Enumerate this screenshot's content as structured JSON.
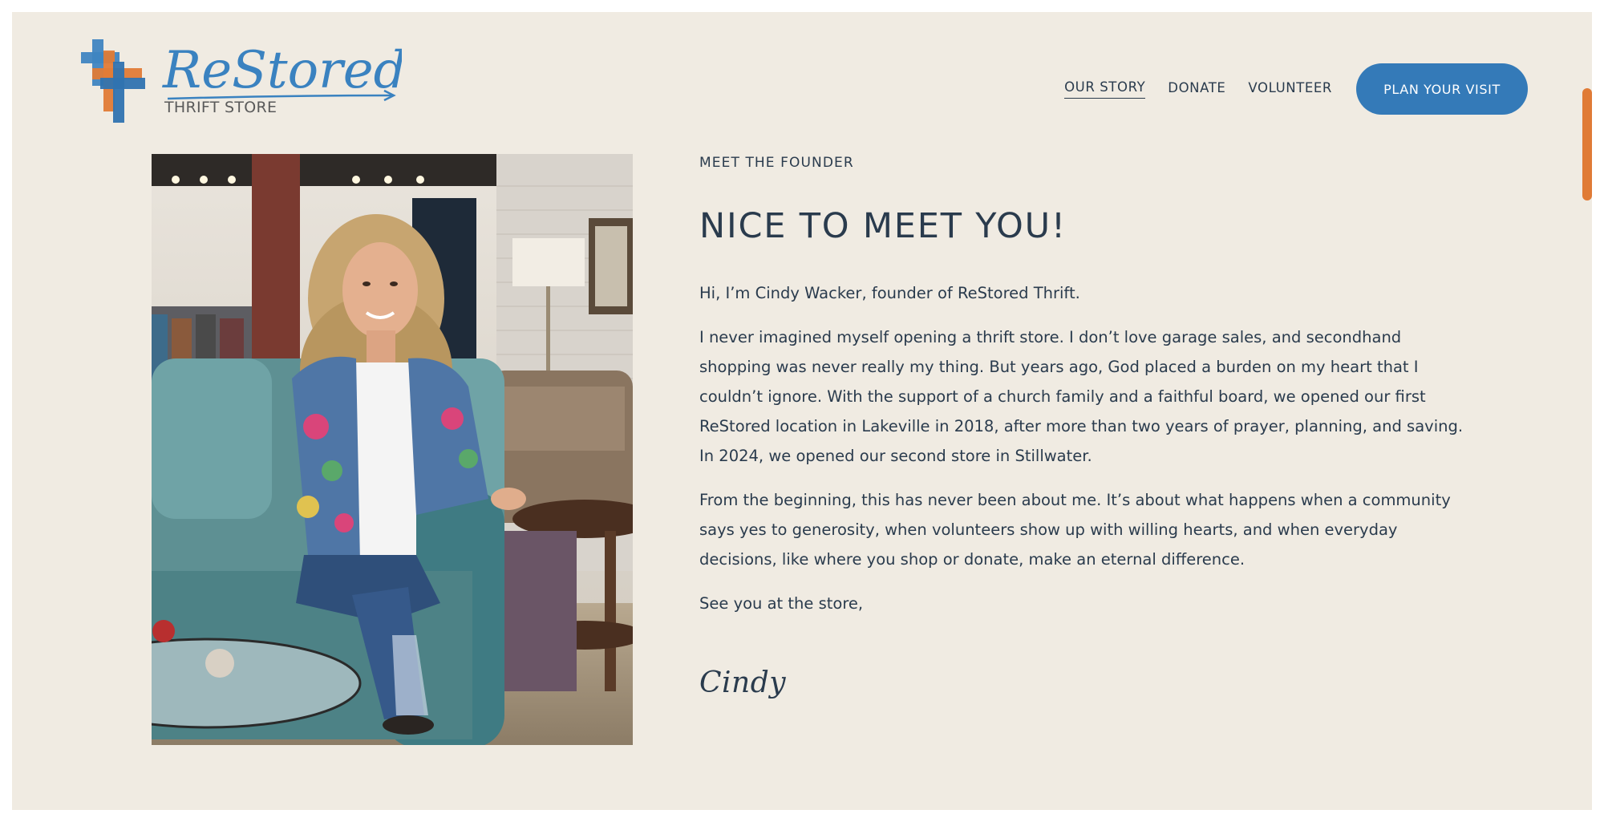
{
  "brand": {
    "name": "ReStored",
    "tagline": "THRIFT STORE"
  },
  "nav": {
    "items": [
      {
        "label": "OUR STORY",
        "active": true
      },
      {
        "label": "DONATE",
        "active": false
      },
      {
        "label": "VOLUNTEER",
        "active": false
      }
    ],
    "cta_label": "PLAN YOUR VISIT"
  },
  "colors": {
    "background": "#f0ebe2",
    "text": "#2a3b4d",
    "accent_blue": "#347ab8",
    "accent_orange": "#e07b36"
  },
  "founder": {
    "eyebrow": "MEET THE FOUNDER",
    "headline": "NICE TO MEET YOU!",
    "paragraphs": [
      "Hi, I’m Cindy Wacker, founder of ReStored Thrift.",
      "I never imagined myself opening a thrift store. I don’t love garage sales, and secondhand shopping was never really my thing. But years ago, God placed a burden on my heart that I couldn’t ignore. With the support of a church family and a faithful board, we opened our first ReStored location in Lakeville in 2018, after more than two years of prayer, planning, and saving. In 2024, we opened our second store in Stillwater.",
      "From the beginning, this has never been about me. It’s about what happens when a community says yes to generosity, when volunteers show up with willing hearts, and when everyday decisions, like where you shop or donate, make an eternal difference.",
      "See you at the store,"
    ],
    "signature": "Cindy"
  }
}
